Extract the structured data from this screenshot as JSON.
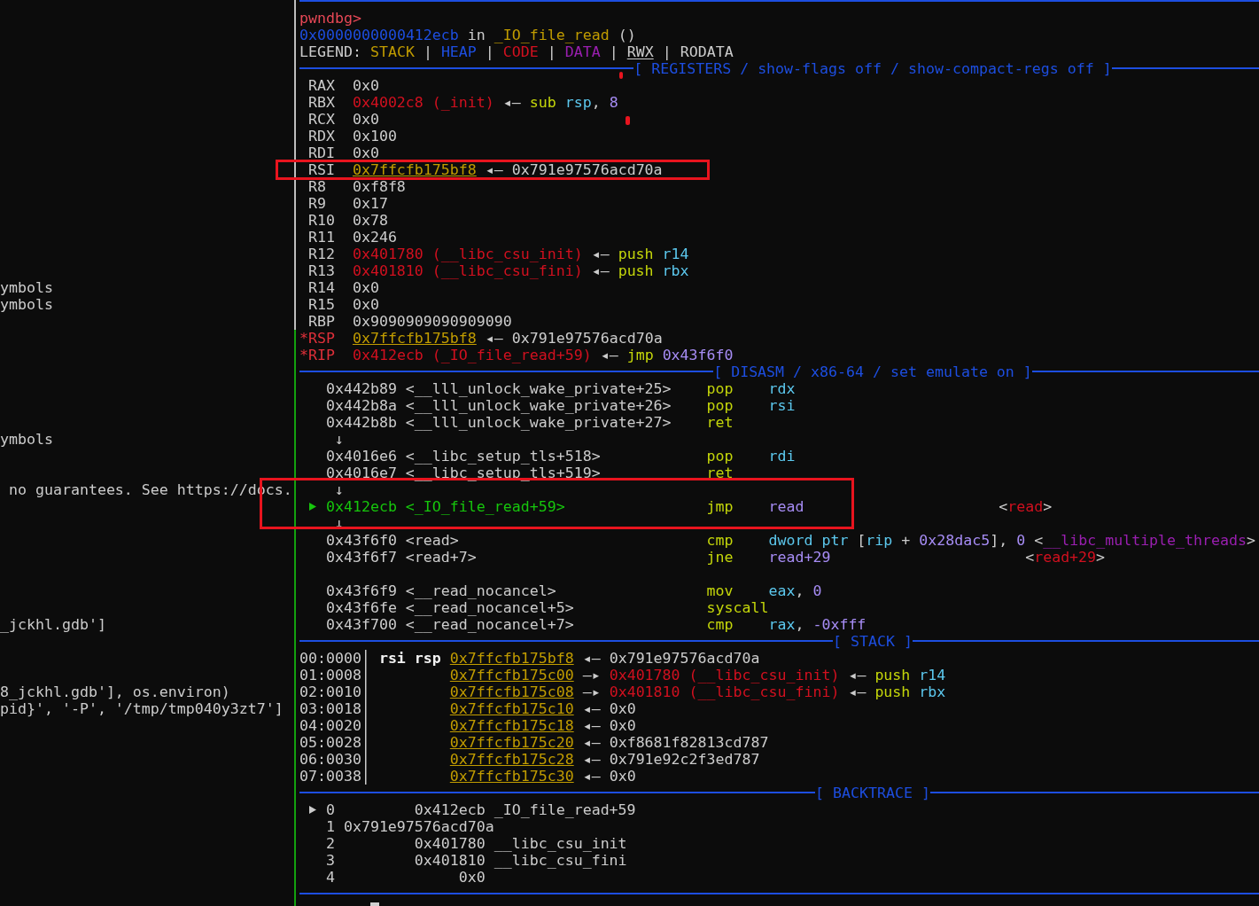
{
  "left_pane": {
    "lines": [
      "ymbols",
      "ymbols",
      "ymbols",
      "no guarantees. See https://docs.",
      "_jckhl.gdb']",
      "8_jckhl.gdb'], os.environ)",
      "pid}', '-P', '/tmp/tmp040y3zt7']"
    ]
  },
  "session": {
    "prompt": "pwndbg>",
    "location": [
      {
        "text": "0x0000000000412ecb",
        "kind": "address"
      },
      {
        "text": " in ",
        "kind": "plain"
      },
      {
        "text": "_IO_file_read",
        "kind": "function"
      },
      {
        "text": " ()",
        "kind": "plain"
      }
    ],
    "legend": [
      {
        "text": "LEGEND: ",
        "kind": "plain"
      },
      {
        "text": "STACK",
        "kind": "stack"
      },
      {
        "text": " | ",
        "kind": "plain"
      },
      {
        "text": "HEAP",
        "kind": "heap"
      },
      {
        "text": " | ",
        "kind": "plain"
      },
      {
        "text": "CODE",
        "kind": "code"
      },
      {
        "text": " | ",
        "kind": "plain"
      },
      {
        "text": "DATA",
        "kind": "data"
      },
      {
        "text": " | ",
        "kind": "plain"
      },
      {
        "text": "RWX",
        "kind": "rwx"
      },
      {
        "text": " | ",
        "kind": "plain"
      },
      {
        "text": "RODATA",
        "kind": "plain"
      }
    ]
  },
  "registers": {
    "header": "[ REGISTERS / show-flags off / show-compact-regs off ]",
    "rows": [
      {
        "name": "RAX",
        "changed": false,
        "value": [
          {
            "text": "0x0",
            "kind": "plain"
          }
        ]
      },
      {
        "name": "RBX",
        "changed": false,
        "value": [
          {
            "text": "0x4002c8 (_init)",
            "kind": "code"
          },
          {
            "text": " ◂— ",
            "kind": "plain"
          },
          {
            "text": "sub ",
            "kind": "mnemonic"
          },
          {
            "text": "rsp",
            "kind": "register"
          },
          {
            "text": ", ",
            "kind": "plain"
          },
          {
            "text": "8",
            "kind": "immediate"
          }
        ]
      },
      {
        "name": "RCX",
        "changed": false,
        "value": [
          {
            "text": "0x0",
            "kind": "plain"
          }
        ]
      },
      {
        "name": "RDX",
        "changed": false,
        "value": [
          {
            "text": "0x100",
            "kind": "plain"
          }
        ]
      },
      {
        "name": "RDI",
        "changed": false,
        "value": [
          {
            "text": "0x0",
            "kind": "plain"
          }
        ]
      },
      {
        "name": "RSI",
        "changed": false,
        "value": [
          {
            "text": "0x7ffcfb175bf8",
            "kind": "stack-rwx"
          },
          {
            "text": " ◂— ",
            "kind": "plain"
          },
          {
            "text": "0x791e97576acd70a",
            "kind": "plain"
          }
        ]
      },
      {
        "name": "R8",
        "changed": false,
        "value": [
          {
            "text": "0xf8f8",
            "kind": "plain"
          }
        ]
      },
      {
        "name": "R9",
        "changed": false,
        "value": [
          {
            "text": "0x17",
            "kind": "plain"
          }
        ]
      },
      {
        "name": "R10",
        "changed": false,
        "value": [
          {
            "text": "0x78",
            "kind": "plain"
          }
        ]
      },
      {
        "name": "R11",
        "changed": false,
        "value": [
          {
            "text": "0x246",
            "kind": "plain"
          }
        ]
      },
      {
        "name": "R12",
        "changed": false,
        "value": [
          {
            "text": "0x401780 (__libc_csu_init)",
            "kind": "code"
          },
          {
            "text": " ◂— ",
            "kind": "plain"
          },
          {
            "text": "push ",
            "kind": "mnemonic"
          },
          {
            "text": "r14",
            "kind": "register"
          }
        ]
      },
      {
        "name": "R13",
        "changed": false,
        "value": [
          {
            "text": "0x401810 (__libc_csu_fini)",
            "kind": "code"
          },
          {
            "text": " ◂— ",
            "kind": "plain"
          },
          {
            "text": "push ",
            "kind": "mnemonic"
          },
          {
            "text": "rbx",
            "kind": "register"
          }
        ]
      },
      {
        "name": "R14",
        "changed": false,
        "value": [
          {
            "text": "0x0",
            "kind": "plain"
          }
        ]
      },
      {
        "name": "R15",
        "changed": false,
        "value": [
          {
            "text": "0x0",
            "kind": "plain"
          }
        ]
      },
      {
        "name": "RBP",
        "changed": false,
        "value": [
          {
            "text": "0x9090909090909090",
            "kind": "plain"
          }
        ]
      },
      {
        "name": "*RSP",
        "changed": true,
        "value": [
          {
            "text": "0x7ffcfb175bf8",
            "kind": "stack-rwx"
          },
          {
            "text": " ◂— ",
            "kind": "plain"
          },
          {
            "text": "0x791e97576acd70a",
            "kind": "plain"
          }
        ]
      },
      {
        "name": "*RIP",
        "changed": true,
        "value": [
          {
            "text": "0x412ecb (_IO_file_read+59)",
            "kind": "code"
          },
          {
            "text": " ◂— ",
            "kind": "plain"
          },
          {
            "text": "jmp ",
            "kind": "mnemonic"
          },
          {
            "text": "0x43f6f0",
            "kind": "immediate"
          }
        ]
      }
    ]
  },
  "disasm": {
    "header": "[ DISASM / x86-64 / set emulate on ]",
    "lines": [
      {
        "kind": "instruction",
        "current": false,
        "location": "0x442b89 <__lll_unlock_wake_private+25>",
        "mnemonic": "pop",
        "operands": [
          {
            "text": "rdx",
            "kind": "register"
          }
        ]
      },
      {
        "kind": "instruction",
        "current": false,
        "location": "0x442b8a <__lll_unlock_wake_private+26>",
        "mnemonic": "pop",
        "operands": [
          {
            "text": "rsi",
            "kind": "register"
          }
        ]
      },
      {
        "kind": "instruction",
        "current": false,
        "location": "0x442b8b <__lll_unlock_wake_private+27>",
        "mnemonic": "ret"
      },
      {
        "kind": "jump-arrow",
        "text": "↓"
      },
      {
        "kind": "instruction",
        "current": false,
        "location": "0x4016e6 <__libc_setup_tls+518>",
        "mnemonic": "pop",
        "operands": [
          {
            "text": "rdi",
            "kind": "register"
          }
        ]
      },
      {
        "kind": "instruction",
        "current": false,
        "location": "0x4016e7 <__libc_setup_tls+519>",
        "mnemonic": "ret"
      },
      {
        "kind": "jump-arrow",
        "text": "↓"
      },
      {
        "kind": "instruction",
        "current": true,
        "location": "0x412ecb <_IO_file_read+59>",
        "mnemonic": "jmp",
        "operands": [
          {
            "text": "read",
            "kind": "immediate"
          }
        ],
        "comment": [
          {
            "text": "<",
            "kind": "plain"
          },
          {
            "text": "read",
            "kind": "code"
          },
          {
            "text": ">",
            "kind": "plain"
          }
        ]
      },
      {
        "kind": "jump-arrow",
        "text": "↓"
      },
      {
        "kind": "instruction",
        "current": false,
        "location": "0x43f6f0 <read>",
        "mnemonic": "cmp",
        "operands": [
          {
            "text": "dword ptr ",
            "kind": "register"
          },
          {
            "text": "[",
            "kind": "plain"
          },
          {
            "text": "rip",
            "kind": "register"
          },
          {
            "text": " + ",
            "kind": "plain"
          },
          {
            "text": "0x28dac5",
            "kind": "immediate"
          },
          {
            "text": "], ",
            "kind": "plain"
          },
          {
            "text": "0",
            "kind": "immediate"
          }
        ],
        "comment": [
          {
            "text": "<",
            "kind": "plain"
          },
          {
            "text": "__libc_multiple_threads",
            "kind": "data"
          },
          {
            "text": ">",
            "kind": "plain"
          }
        ]
      },
      {
        "kind": "instruction",
        "current": false,
        "location": "0x43f6f7 <read+7>",
        "mnemonic": "jne",
        "operands": [
          {
            "text": "read+29",
            "kind": "immediate"
          }
        ],
        "comment": [
          {
            "text": "<",
            "kind": "plain"
          },
          {
            "text": "read+29",
            "kind": "code"
          },
          {
            "text": ">",
            "kind": "plain"
          }
        ]
      },
      {
        "kind": "blank"
      },
      {
        "kind": "instruction",
        "current": false,
        "location": "0x43f6f9 <__read_nocancel>",
        "mnemonic": "mov",
        "operands": [
          {
            "text": "eax",
            "kind": "register"
          },
          {
            "text": ", ",
            "kind": "plain"
          },
          {
            "text": "0",
            "kind": "immediate"
          }
        ]
      },
      {
        "kind": "instruction",
        "current": false,
        "location": "0x43f6fe <__read_nocancel+5>",
        "mnemonic": "syscall"
      },
      {
        "kind": "instruction",
        "current": false,
        "location": "0x43f700 <__read_nocancel+7>",
        "mnemonic": "cmp",
        "operands": [
          {
            "text": "rax",
            "kind": "register"
          },
          {
            "text": ", ",
            "kind": "plain"
          },
          {
            "text": "-0xfff",
            "kind": "immediate"
          }
        ]
      }
    ]
  },
  "stack": {
    "header": "[ STACK ]",
    "rows": [
      {
        "offset": "00:0000",
        "labels": "rsi rsp",
        "entry": [
          {
            "text": "0x7ffcfb175bf8",
            "kind": "stack-rwx"
          },
          {
            "text": " ◂— ",
            "kind": "plain"
          },
          {
            "text": "0x791e97576acd70a",
            "kind": "plain"
          }
        ]
      },
      {
        "offset": "01:0008",
        "entry": [
          {
            "text": "0x7ffcfb175c00",
            "kind": "stack-rwx"
          },
          {
            "text": " —▸ ",
            "kind": "plain"
          },
          {
            "text": "0x401780 (__libc_csu_init)",
            "kind": "code"
          },
          {
            "text": " ◂— ",
            "kind": "plain"
          },
          {
            "text": "push ",
            "kind": "mnemonic"
          },
          {
            "text": "r14",
            "kind": "register"
          }
        ]
      },
      {
        "offset": "02:0010",
        "entry": [
          {
            "text": "0x7ffcfb175c08",
            "kind": "stack-rwx"
          },
          {
            "text": " —▸ ",
            "kind": "plain"
          },
          {
            "text": "0x401810 (__libc_csu_fini)",
            "kind": "code"
          },
          {
            "text": " ◂— ",
            "kind": "plain"
          },
          {
            "text": "push ",
            "kind": "mnemonic"
          },
          {
            "text": "rbx",
            "kind": "register"
          }
        ]
      },
      {
        "offset": "03:0018",
        "entry": [
          {
            "text": "0x7ffcfb175c10",
            "kind": "stack-rwx"
          },
          {
            "text": " ◂— ",
            "kind": "plain"
          },
          {
            "text": "0x0",
            "kind": "plain"
          }
        ]
      },
      {
        "offset": "04:0020",
        "entry": [
          {
            "text": "0x7ffcfb175c18",
            "kind": "stack-rwx"
          },
          {
            "text": " ◂— ",
            "kind": "plain"
          },
          {
            "text": "0x0",
            "kind": "plain"
          }
        ]
      },
      {
        "offset": "05:0028",
        "entry": [
          {
            "text": "0x7ffcfb175c20",
            "kind": "stack-rwx"
          },
          {
            "text": " ◂— ",
            "kind": "plain"
          },
          {
            "text": "0xf8681f82813cd787",
            "kind": "plain"
          }
        ]
      },
      {
        "offset": "06:0030",
        "entry": [
          {
            "text": "0x7ffcfb175c28",
            "kind": "stack-rwx"
          },
          {
            "text": " ◂— ",
            "kind": "plain"
          },
          {
            "text": "0x791e92c2f3ed787",
            "kind": "plain"
          }
        ]
      },
      {
        "offset": "07:0038",
        "entry": [
          {
            "text": "0x7ffcfb175c30",
            "kind": "stack-rwx"
          },
          {
            "text": " ◂— ",
            "kind": "plain"
          },
          {
            "text": "0x0",
            "kind": "plain"
          }
        ]
      }
    ]
  },
  "backtrace": {
    "header": "[ BACKTRACE ]",
    "frames": [
      {
        "index": "0",
        "selected": true,
        "address": "0x412ecb",
        "symbol": "_IO_file_read+59"
      },
      {
        "index": "1",
        "selected": false,
        "address": "0x791e97576acd70a"
      },
      {
        "index": "2",
        "selected": false,
        "address": "0x401780",
        "symbol": "__libc_csu_init"
      },
      {
        "index": "3",
        "selected": false,
        "address": "0x401810",
        "symbol": "__libc_csu_fini"
      },
      {
        "index": "4",
        "selected": false,
        "address": "0x0"
      }
    ]
  }
}
